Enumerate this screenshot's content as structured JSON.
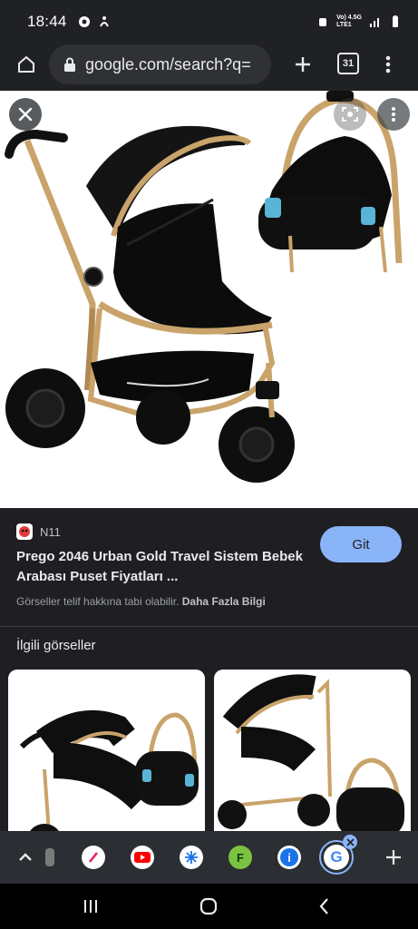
{
  "status_bar": {
    "time": "18:44",
    "network_top": "Vo) 4.5G",
    "network_bottom": "LTE1"
  },
  "url_bar": {
    "url": "google.com/search?q=",
    "tab_count": "31"
  },
  "viewer": {
    "close_icon": "close-icon",
    "lens_icon": "lens-icon",
    "more_icon": "more-vert-icon"
  },
  "result": {
    "source_name": "N11",
    "title": "Prego 2046 Urban Gold Travel Sistem Bebek Arabası Puset Fiyatları ...",
    "visit_button": "Git",
    "copyright_text": "Görseller telif hakkına tabi olabilir.",
    "more_info_link": "Daha Fazla Bilgi"
  },
  "related": {
    "heading": "İlgili görseller"
  },
  "tab_strip": {
    "items": [
      "chevron-up-icon",
      "tab-favicon-1",
      "youtube-icon",
      "snowflake-icon",
      "f-icon",
      "info-icon",
      "google-icon"
    ],
    "f_label": "F",
    "info_label": "i",
    "google_label": "G"
  },
  "nav_bar": {
    "items": [
      "recents-icon",
      "home-icon",
      "back-icon"
    ]
  },
  "colors": {
    "accent": "#8ab4f8",
    "background": "#1f1f23",
    "stroller_gold": "#c9a36a"
  }
}
